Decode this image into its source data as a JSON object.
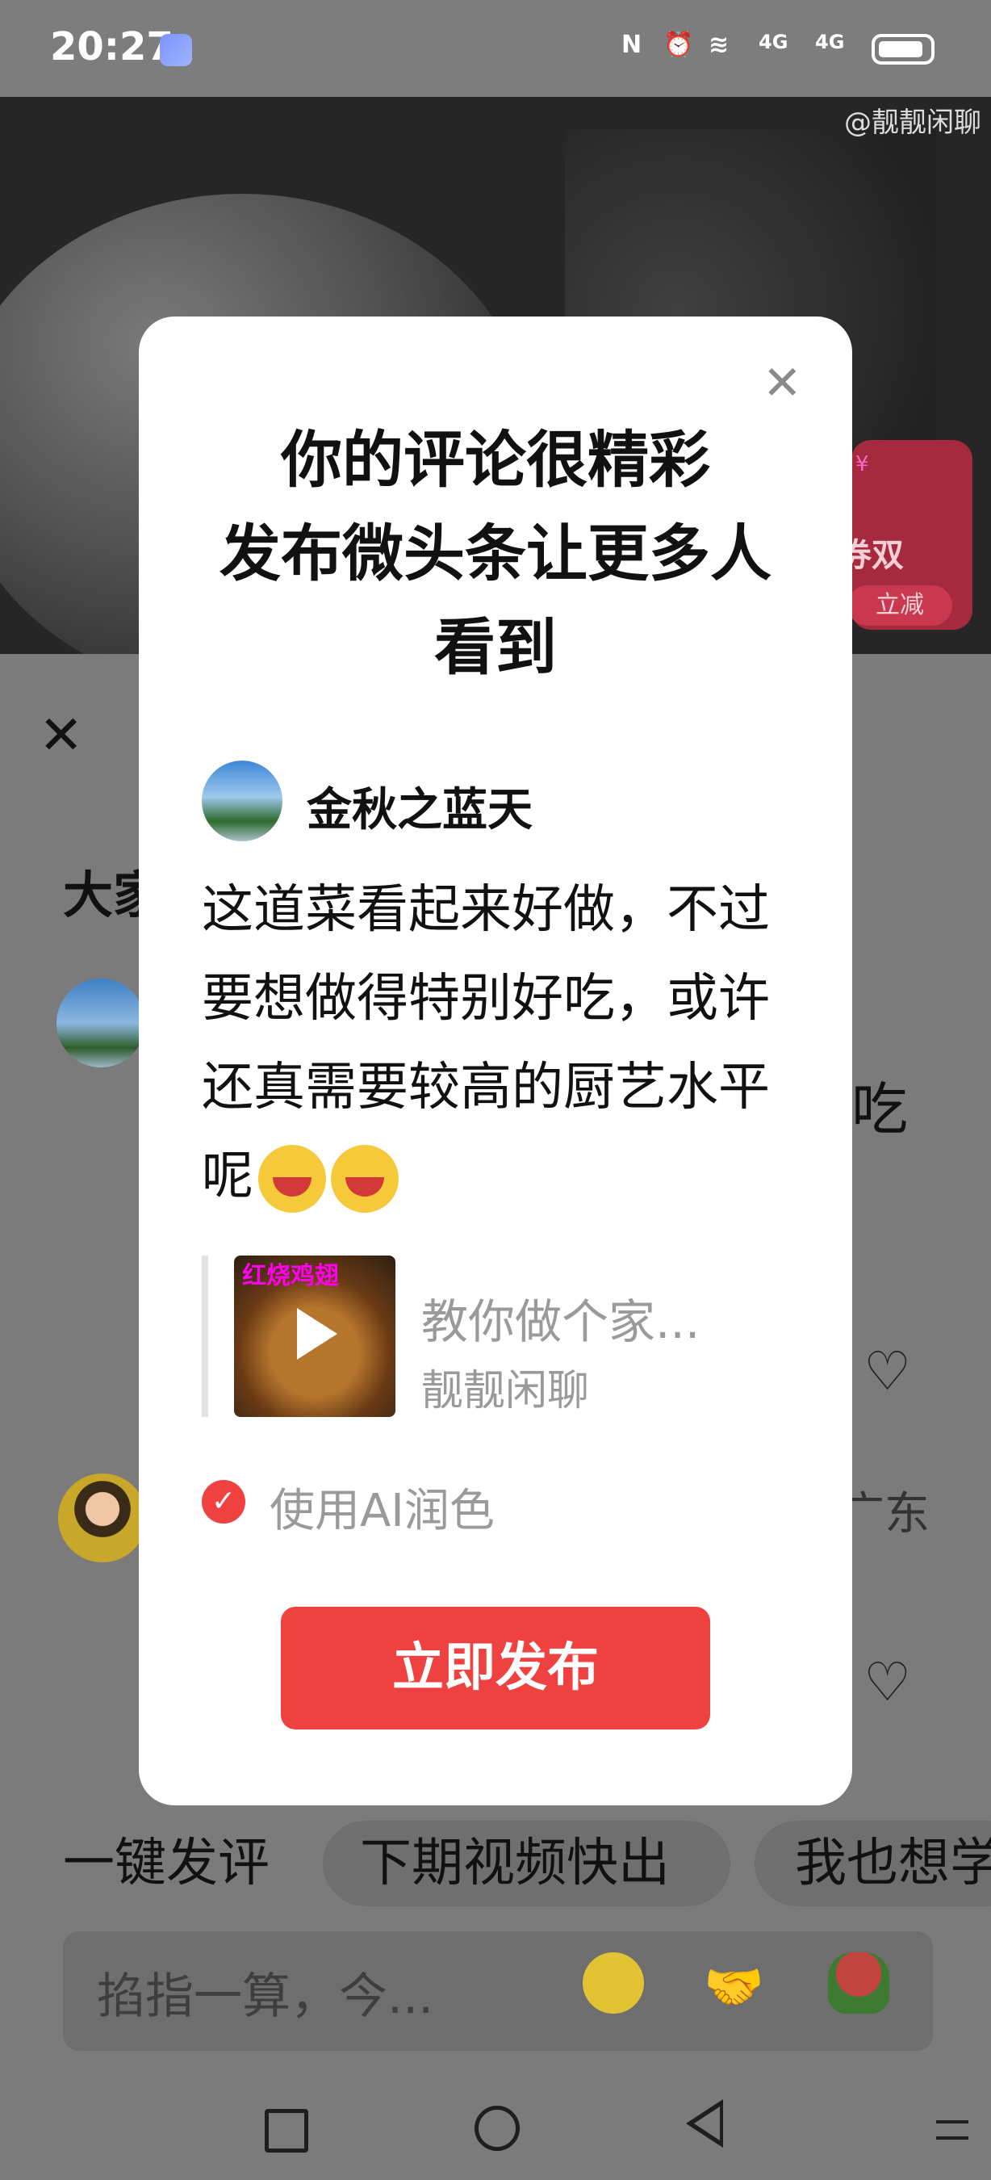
{
  "status_bar": {
    "time": "20:27",
    "icons": [
      "nfc-icon",
      "alarm-icon",
      "wifi-icon",
      "signal-4g-icon",
      "signal-4g-icon",
      "battery-icon"
    ],
    "signal_label_1": "4G",
    "signal_label_2": "4G"
  },
  "video": {
    "watermark": "@靓靓闲聊",
    "promo_line1": "券双",
    "promo_line2": "立减"
  },
  "comment_sheet": {
    "heading_partial": "大家",
    "behind_text_1": "吃",
    "behind_text_2": "广东",
    "quick_replies": [
      "一键发评",
      "下期视频快出",
      "我也想学"
    ],
    "input_placeholder": "掐指一算，今..."
  },
  "modal": {
    "title": "你的评论很精彩\n发布微头条让更多人\n看到",
    "author_name": "金秋之蓝天",
    "comment_text": "这道菜看起来好做，不过要想做得特别好吃，或许还真需要较高的厨艺水平呢",
    "video_thumb_caption": "红烧鸡翅",
    "video_title": "教你做个家...",
    "video_author": "靓靓闲聊",
    "ai_polish_label": "使用AI润色",
    "ai_polish_checked": true,
    "publish_label": "立即发布"
  },
  "colors": {
    "accent_red": "#f04141",
    "dim_overlay": "#7b7b7b"
  }
}
